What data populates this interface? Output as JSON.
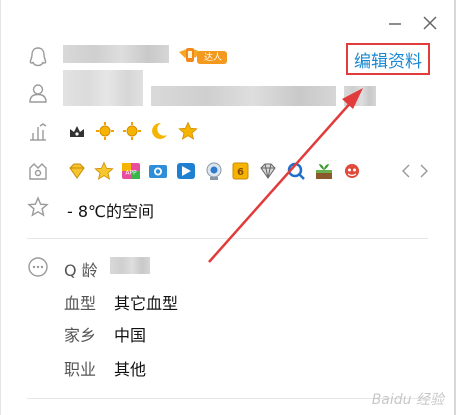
{
  "window": {
    "minimize_icon": "minimize-icon",
    "close_icon": "close-icon"
  },
  "profile": {
    "edit_label": "编辑资料",
    "talent_tag_label": "达人",
    "space_label": "- 8℃的空间"
  },
  "details": {
    "qage_label": "Q 龄",
    "blood_label": "血型",
    "blood_value": "其它血型",
    "hometown_label": "家乡",
    "hometown_value": "中国",
    "job_label": "职业",
    "job_value": "其他"
  },
  "watermark": "Baidu 经验",
  "colors": {
    "accent_blue": "#1a88d3",
    "highlight_red": "#e23b3b",
    "icon_gray": "#9a9a9a"
  }
}
